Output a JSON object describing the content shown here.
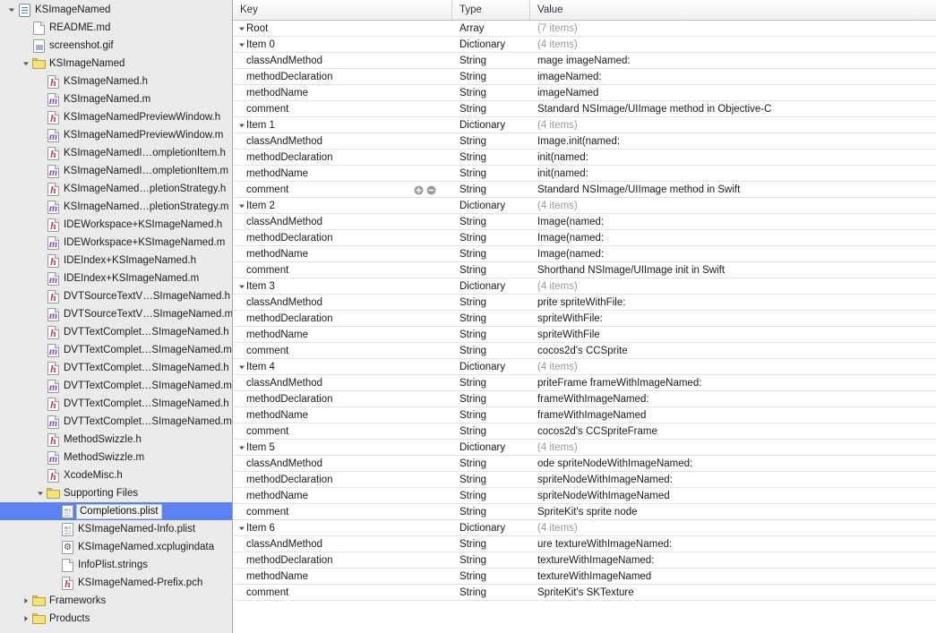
{
  "navigator": {
    "items": [
      {
        "label": "KSImageNamed",
        "indent": 0,
        "icon": "xcode-project-icon",
        "disclosure": "down"
      },
      {
        "label": "README.md",
        "indent": 1,
        "icon": "blank-document-icon",
        "disclosure": "none"
      },
      {
        "label": "screenshot.gif",
        "indent": 1,
        "icon": "image-file-icon",
        "disclosure": "none"
      },
      {
        "label": "KSImageNamed",
        "indent": 1,
        "icon": "folder-icon",
        "disclosure": "down"
      },
      {
        "label": "KSImageNamed.h",
        "indent": 2,
        "icon": "header-file-icon",
        "disclosure": "none"
      },
      {
        "label": "KSImageNamed.m",
        "indent": 2,
        "icon": "implementation-file-icon",
        "disclosure": "none"
      },
      {
        "label": "KSImageNamedPreviewWindow.h",
        "indent": 2,
        "icon": "header-file-icon",
        "disclosure": "none"
      },
      {
        "label": "KSImageNamedPreviewWindow.m",
        "indent": 2,
        "icon": "implementation-file-icon",
        "disclosure": "none"
      },
      {
        "label": "KSImageNamedI…ompletionItem.h",
        "indent": 2,
        "icon": "header-file-icon",
        "disclosure": "none"
      },
      {
        "label": "KSImageNamedI…ompletionItem.m",
        "indent": 2,
        "icon": "implementation-file-icon",
        "disclosure": "none"
      },
      {
        "label": "KSImageNamed…pletionStrategy.h",
        "indent": 2,
        "icon": "header-file-icon",
        "disclosure": "none"
      },
      {
        "label": "KSImageNamed…pletionStrategy.m",
        "indent": 2,
        "icon": "implementation-file-icon",
        "disclosure": "none"
      },
      {
        "label": "IDEWorkspace+KSImageNamed.h",
        "indent": 2,
        "icon": "header-file-icon",
        "disclosure": "none"
      },
      {
        "label": "IDEWorkspace+KSImageNamed.m",
        "indent": 2,
        "icon": "implementation-file-icon",
        "disclosure": "none"
      },
      {
        "label": "IDEIndex+KSImageNamed.h",
        "indent": 2,
        "icon": "header-file-icon",
        "disclosure": "none"
      },
      {
        "label": "IDEIndex+KSImageNamed.m",
        "indent": 2,
        "icon": "implementation-file-icon",
        "disclosure": "none"
      },
      {
        "label": "DVTSourceTextV…SImageNamed.h",
        "indent": 2,
        "icon": "header-file-icon",
        "disclosure": "none"
      },
      {
        "label": "DVTSourceTextV…SImageNamed.m",
        "indent": 2,
        "icon": "implementation-file-icon",
        "disclosure": "none"
      },
      {
        "label": "DVTTextComplet…SImageNamed.h",
        "indent": 2,
        "icon": "header-file-icon",
        "disclosure": "none"
      },
      {
        "label": "DVTTextComplet…SImageNamed.m",
        "indent": 2,
        "icon": "implementation-file-icon",
        "disclosure": "none"
      },
      {
        "label": "DVTTextComplet…SImageNamed.h",
        "indent": 2,
        "icon": "header-file-icon",
        "disclosure": "none"
      },
      {
        "label": "DVTTextComplet…SImageNamed.m",
        "indent": 2,
        "icon": "implementation-file-icon",
        "disclosure": "none"
      },
      {
        "label": "DVTTextComplet…SImageNamed.h",
        "indent": 2,
        "icon": "header-file-icon",
        "disclosure": "none"
      },
      {
        "label": "DVTTextComplet…SImageNamed.m",
        "indent": 2,
        "icon": "implementation-file-icon",
        "disclosure": "none"
      },
      {
        "label": "MethodSwizzle.h",
        "indent": 2,
        "icon": "header-file-icon",
        "disclosure": "none"
      },
      {
        "label": "MethodSwizzle.m",
        "indent": 2,
        "icon": "implementation-file-icon",
        "disclosure": "none"
      },
      {
        "label": "XcodeMisc.h",
        "indent": 2,
        "icon": "header-file-icon",
        "disclosure": "none"
      },
      {
        "label": "Supporting Files",
        "indent": 2,
        "icon": "folder-icon",
        "disclosure": "down"
      },
      {
        "label": "Completions.plist",
        "indent": 3,
        "icon": "plist-file-icon",
        "disclosure": "none",
        "selected": true
      },
      {
        "label": "KSImageNamed-Info.plist",
        "indent": 3,
        "icon": "plist-file-icon",
        "disclosure": "none"
      },
      {
        "label": "KSImageNamed.xcplugindata",
        "indent": 3,
        "icon": "plugindata-file-icon",
        "disclosure": "none"
      },
      {
        "label": "InfoPlist.strings",
        "indent": 3,
        "icon": "blank-document-icon",
        "disclosure": "none"
      },
      {
        "label": "KSImageNamed-Prefix.pch",
        "indent": 3,
        "icon": "header-file-icon",
        "disclosure": "none"
      },
      {
        "label": "Frameworks",
        "indent": 1,
        "icon": "folder-icon",
        "disclosure": "right"
      },
      {
        "label": "Products",
        "indent": 1,
        "icon": "folder-icon",
        "disclosure": "right"
      }
    ]
  },
  "plist": {
    "columns": {
      "key": "Key",
      "type": "Type",
      "value": "Value"
    },
    "rows": [
      {
        "key": "Root",
        "type": "Array",
        "value": "(7 items)",
        "indent": 0,
        "disclosure": "down",
        "muted": true
      },
      {
        "key": "Item 0",
        "type": "Dictionary",
        "value": "(4 items)",
        "indent": 1,
        "disclosure": "down",
        "muted": true
      },
      {
        "key": "classAndMethod",
        "type": "String",
        "value": "mage imageNamed:",
        "indent": 2,
        "disclosure": "none"
      },
      {
        "key": "methodDeclaration",
        "type": "String",
        "value": " imageNamed:",
        "indent": 2,
        "disclosure": "none"
      },
      {
        "key": "methodName",
        "type": "String",
        "value": "imageNamed",
        "indent": 2,
        "disclosure": "none"
      },
      {
        "key": "comment",
        "type": "String",
        "value": "Standard NSImage/UIImage method in Objective-C",
        "indent": 2,
        "disclosure": "none"
      },
      {
        "key": "Item 1",
        "type": "Dictionary",
        "value": "(4 items)",
        "indent": 1,
        "disclosure": "down",
        "muted": true
      },
      {
        "key": "classAndMethod",
        "type": "String",
        "value": "Image.init(named:",
        "indent": 2,
        "disclosure": "none"
      },
      {
        "key": "methodDeclaration",
        "type": "String",
        "value": " init(named:",
        "indent": 2,
        "disclosure": "none"
      },
      {
        "key": "methodName",
        "type": "String",
        "value": "init(named:",
        "indent": 2,
        "disclosure": "none"
      },
      {
        "key": "comment",
        "type": "String",
        "value": "Standard NSImage/UIImage method in Swift",
        "indent": 2,
        "disclosure": "none",
        "hover": true
      },
      {
        "key": "Item 2",
        "type": "Dictionary",
        "value": "(4 items)",
        "indent": 1,
        "disclosure": "down",
        "muted": true
      },
      {
        "key": "classAndMethod",
        "type": "String",
        "value": "Image(named:",
        "indent": 2,
        "disclosure": "none"
      },
      {
        "key": "methodDeclaration",
        "type": "String",
        "value": "Image(named:",
        "indent": 2,
        "disclosure": "none"
      },
      {
        "key": "methodName",
        "type": "String",
        "value": "Image(named:",
        "indent": 2,
        "disclosure": "none"
      },
      {
        "key": "comment",
        "type": "String",
        "value": "Shorthand NSImage/UIImage init in Swift",
        "indent": 2,
        "disclosure": "none"
      },
      {
        "key": "Item 3",
        "type": "Dictionary",
        "value": "(4 items)",
        "indent": 1,
        "disclosure": "down",
        "muted": true
      },
      {
        "key": "classAndMethod",
        "type": "String",
        "value": "prite spriteWithFile:",
        "indent": 2,
        "disclosure": "none"
      },
      {
        "key": "methodDeclaration",
        "type": "String",
        "value": " spriteWithFile:",
        "indent": 2,
        "disclosure": "none"
      },
      {
        "key": "methodName",
        "type": "String",
        "value": "spriteWithFile",
        "indent": 2,
        "disclosure": "none"
      },
      {
        "key": "comment",
        "type": "String",
        "value": "cocos2d's CCSprite",
        "indent": 2,
        "disclosure": "none"
      },
      {
        "key": "Item 4",
        "type": "Dictionary",
        "value": "(4 items)",
        "indent": 1,
        "disclosure": "down",
        "muted": true
      },
      {
        "key": "classAndMethod",
        "type": "String",
        "value": "priteFrame frameWithImageNamed:",
        "indent": 2,
        "disclosure": "none"
      },
      {
        "key": "methodDeclaration",
        "type": "String",
        "value": " frameWithImageNamed:",
        "indent": 2,
        "disclosure": "none"
      },
      {
        "key": "methodName",
        "type": "String",
        "value": "frameWithImageNamed",
        "indent": 2,
        "disclosure": "none"
      },
      {
        "key": "comment",
        "type": "String",
        "value": "cocos2d's CCSpriteFrame",
        "indent": 2,
        "disclosure": "none"
      },
      {
        "key": "Item 5",
        "type": "Dictionary",
        "value": "(4 items)",
        "indent": 1,
        "disclosure": "down",
        "muted": true
      },
      {
        "key": "classAndMethod",
        "type": "String",
        "value": "ode spriteNodeWithImageNamed:",
        "indent": 2,
        "disclosure": "none"
      },
      {
        "key": "methodDeclaration",
        "type": "String",
        "value": " spriteNodeWithImageNamed:",
        "indent": 2,
        "disclosure": "none"
      },
      {
        "key": "methodName",
        "type": "String",
        "value": "spriteNodeWithImageNamed",
        "indent": 2,
        "disclosure": "none"
      },
      {
        "key": "comment",
        "type": "String",
        "value": "SpriteKit's sprite node",
        "indent": 2,
        "disclosure": "none"
      },
      {
        "key": "Item 6",
        "type": "Dictionary",
        "value": "(4 items)",
        "indent": 1,
        "disclosure": "down",
        "muted": true
      },
      {
        "key": "classAndMethod",
        "type": "String",
        "value": "ure textureWithImageNamed:",
        "indent": 2,
        "disclosure": "none"
      },
      {
        "key": "methodDeclaration",
        "type": "String",
        "value": " textureWithImageNamed:",
        "indent": 2,
        "disclosure": "none"
      },
      {
        "key": "methodName",
        "type": "String",
        "value": "textureWithImageNamed",
        "indent": 2,
        "disclosure": "none"
      },
      {
        "key": "comment",
        "type": "String",
        "value": "SpriteKit's SKTexture",
        "indent": 2,
        "disclosure": "none"
      }
    ]
  },
  "colors": {
    "selection": "#5b82f0",
    "sidebar_bg": "#ebebeb",
    "header_text": "#33363b",
    "muted_text": "#9b9b9b"
  }
}
